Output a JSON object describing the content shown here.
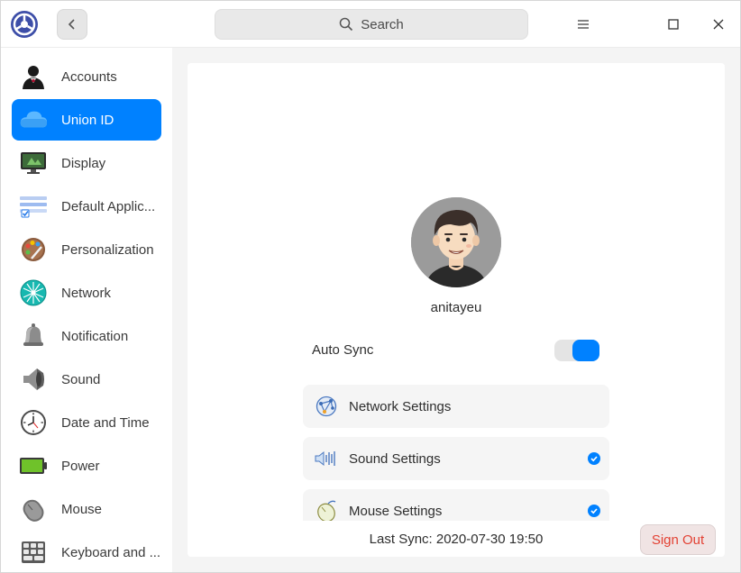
{
  "header": {
    "app_icon": "control-center-logo-icon",
    "back_icon": "chevron-left-icon",
    "search_placeholder": "Search",
    "search_icon": "search-icon",
    "window_buttons": [
      "menu-icon",
      "maximize-icon",
      "close-icon"
    ]
  },
  "sidebar": {
    "items": [
      {
        "label": "Accounts",
        "icon": "accounts-icon"
      },
      {
        "label": "Union ID",
        "icon": "cloud-icon",
        "active": true
      },
      {
        "label": "Display",
        "icon": "display-icon"
      },
      {
        "label": "Default Applic...",
        "icon": "default-apps-icon"
      },
      {
        "label": "Personalization",
        "icon": "palette-icon"
      },
      {
        "label": "Network",
        "icon": "network-icon"
      },
      {
        "label": "Notification",
        "icon": "bell-icon"
      },
      {
        "label": "Sound",
        "icon": "speaker-icon"
      },
      {
        "label": "Date and Time",
        "icon": "clock-icon"
      },
      {
        "label": "Power",
        "icon": "battery-icon"
      },
      {
        "label": "Mouse",
        "icon": "mouse-icon"
      },
      {
        "label": "Keyboard and ...",
        "icon": "keyboard-icon"
      }
    ]
  },
  "main": {
    "username": "anitayeu",
    "auto_sync_label": "Auto Sync",
    "auto_sync_on": true,
    "settings": [
      {
        "label": "Network Settings",
        "icon": "network-settings-icon",
        "checked": false
      },
      {
        "label": "Sound Settings",
        "icon": "sound-settings-icon",
        "checked": true
      },
      {
        "label": "Mouse Settings",
        "icon": "mouse-settings-icon",
        "checked": true
      }
    ],
    "last_sync": "Last Sync: 2020-07-30 19:50",
    "sign_out_label": "Sign Out"
  },
  "colors": {
    "accent": "#0081ff",
    "danger": "#e34234"
  }
}
